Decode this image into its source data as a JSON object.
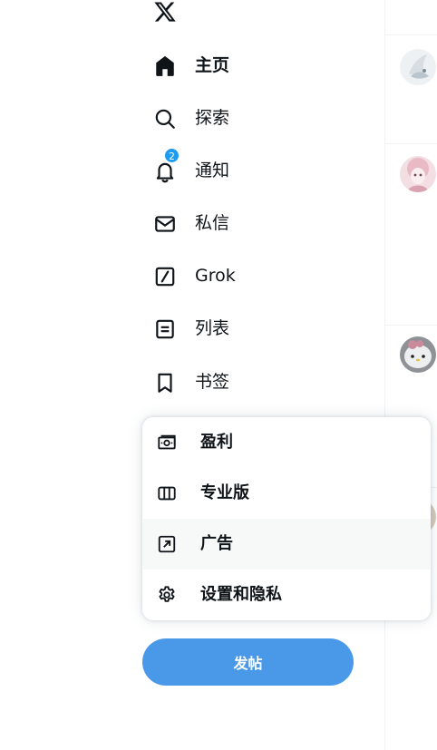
{
  "brand": {
    "logo_icon": "x-logo-icon"
  },
  "nav": {
    "items": [
      {
        "key": "home",
        "label": "主页",
        "icon": "home-icon",
        "active": true
      },
      {
        "key": "explore",
        "label": "探索",
        "icon": "search-icon"
      },
      {
        "key": "notifications",
        "label": "通知",
        "icon": "bell-icon",
        "badge": "2"
      },
      {
        "key": "messages",
        "label": "私信",
        "icon": "mail-icon"
      },
      {
        "key": "grok",
        "label": "Grok",
        "icon": "grok-icon"
      },
      {
        "key": "lists",
        "label": "列表",
        "icon": "list-icon"
      },
      {
        "key": "bookmarks",
        "label": "书签",
        "icon": "bookmark-icon"
      }
    ]
  },
  "more_menu": {
    "items": [
      {
        "key": "monetization",
        "label": "盈利",
        "icon": "money-icon"
      },
      {
        "key": "pro",
        "label": "专业版",
        "icon": "columns-icon"
      },
      {
        "key": "ads",
        "label": "广告",
        "icon": "external-arrow-icon",
        "hovered": true
      },
      {
        "key": "settings",
        "label": "设置和隐私",
        "icon": "gear-icon"
      }
    ]
  },
  "post_button": {
    "label": "发帖"
  },
  "colors": {
    "accent": "#1d9bf0",
    "post_button": "#4a99e9",
    "text": "#0f1419",
    "border": "#eff3f4",
    "hover": "#f7f9f9"
  }
}
